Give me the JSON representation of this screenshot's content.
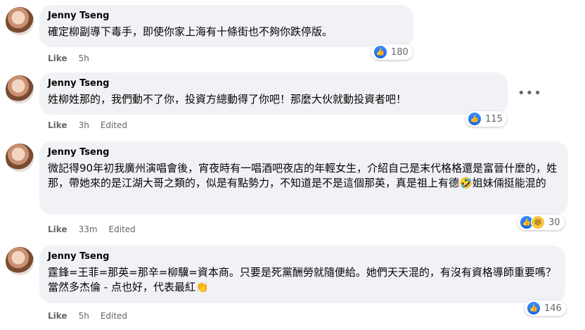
{
  "comments": [
    {
      "author": "Jenny Tseng",
      "text": "確定柳副導下毒手，即使你家上海有十條街也不夠你跌停版。",
      "like_label": "Like",
      "time": "5h",
      "edited": "",
      "reaction_count": "180",
      "reactions": [
        "like-icon"
      ]
    },
    {
      "author": "Jenny Tseng",
      "text": "姓柳姓那的，我們動不了你，投資方總動得了你吧！那麼大伙就動投資者吧！",
      "like_label": "Like",
      "time": "3h",
      "edited": "Edited",
      "reaction_count": "115",
      "reactions": [
        "like-icon"
      ]
    },
    {
      "author": "Jenny Tseng",
      "text_a": "微記得90年初我廣州演唱會後，宵夜時有一唱酒吧夜店的年輕女生，介紹自己是末代格格還是富晉什麼的，姓那，帶她來的是江湖大哥之類的，似是有點勢力，不知道是不是這個那英，真是祖上有德",
      "emoji": "🤣",
      "text_b": "姐妹倆挺能混的",
      "like_label": "Like",
      "time": "33m",
      "edited": "Edited",
      "reaction_count": "30",
      "reactions": [
        "like-icon",
        "haha-icon"
      ]
    },
    {
      "author": "Jenny Tseng",
      "text_a": "霆鋒=王菲=那英=那辛=柳驥=資本商。只要是死黨酬勞就隨便給。她們天天混的，有沒有資格導師重要嗎？當然多杰倫 - 点也好，代表最紅",
      "emoji": "👏",
      "like_label": "Like",
      "time": "5h",
      "edited": "Edited",
      "reaction_count": "146",
      "reactions": [
        "like-icon"
      ]
    }
  ],
  "more_label": "•••"
}
